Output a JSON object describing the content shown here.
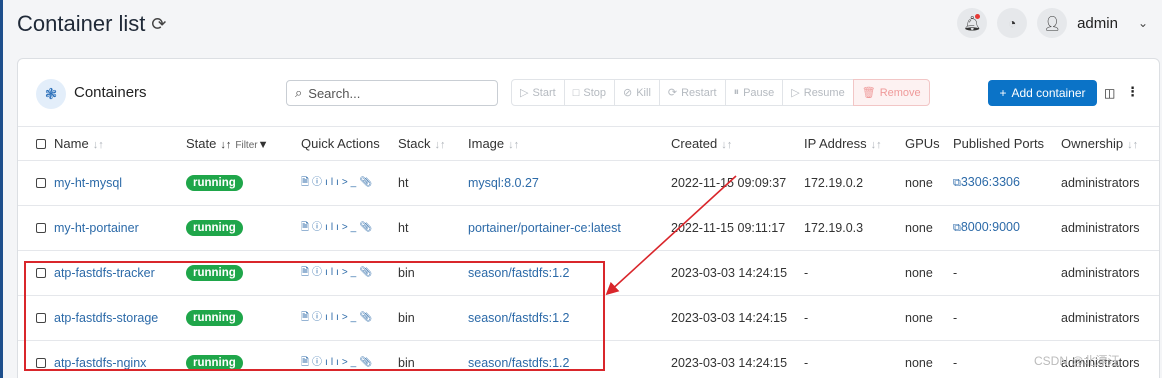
{
  "page": {
    "title": "Container list",
    "user": "admin"
  },
  "colors": {
    "accent": "#0b73c7",
    "running": "#1fa64a",
    "annotation": "#d9262b",
    "link": "#2c6aa8"
  },
  "icons": [
    "refresh-icon",
    "bell-icon",
    "gauge-icon",
    "user-icon",
    "chevron-down-icon",
    "containers-icon",
    "search-icon",
    "plus-icon",
    "columns-icon",
    "kebab-icon",
    "filter-icon",
    "external-link-icon"
  ],
  "card": {
    "title": "Containers"
  },
  "search": {
    "placeholder": "Search..."
  },
  "actions": {
    "start": "Start",
    "stop": "Stop",
    "kill": "Kill",
    "restart": "Restart",
    "pause": "Pause",
    "resume": "Resume",
    "remove": "Remove",
    "add": "Add container"
  },
  "columns": {
    "name": "Name",
    "state": "State",
    "filter": "Filter",
    "quick_actions": "Quick Actions",
    "stack": "Stack",
    "image": "Image",
    "created": "Created",
    "ip": "IP Address",
    "gpus": "GPUs",
    "ports": "Published Ports",
    "ownership": "Ownership"
  },
  "rows": [
    {
      "name": "my-ht-mysql",
      "state": "running",
      "stack": "ht",
      "image": "mysql:8.0.27",
      "created": "2022-11-15 09:09:37",
      "ip": "172.19.0.2",
      "gpus": "none",
      "ports": "3306:3306",
      "ownership": "administrators"
    },
    {
      "name": "my-ht-portainer",
      "state": "running",
      "stack": "ht",
      "image": "portainer/portainer-ce:latest",
      "created": "2022-11-15 09:11:17",
      "ip": "172.19.0.3",
      "gpus": "none",
      "ports": "8000:9000",
      "ownership": "administrators"
    },
    {
      "name": "atp-fastdfs-tracker",
      "state": "running",
      "stack": "bin",
      "image": "season/fastdfs:1.2",
      "created": "2023-03-03 14:24:15",
      "ip": "-",
      "gpus": "none",
      "ports": "-",
      "ownership": "administrators"
    },
    {
      "name": "atp-fastdfs-storage",
      "state": "running",
      "stack": "bin",
      "image": "season/fastdfs:1.2",
      "created": "2023-03-03 14:24:15",
      "ip": "-",
      "gpus": "none",
      "ports": "-",
      "ownership": "administrators"
    },
    {
      "name": "atp-fastdfs-nginx",
      "state": "running",
      "stack": "bin",
      "image": "season/fastdfs:1.2",
      "created": "2023-03-03 14:24:15",
      "ip": "-",
      "gpus": "none",
      "ports": "-",
      "ownership": "administrators"
    }
  ],
  "watermark": "CSDN @北漂汪"
}
